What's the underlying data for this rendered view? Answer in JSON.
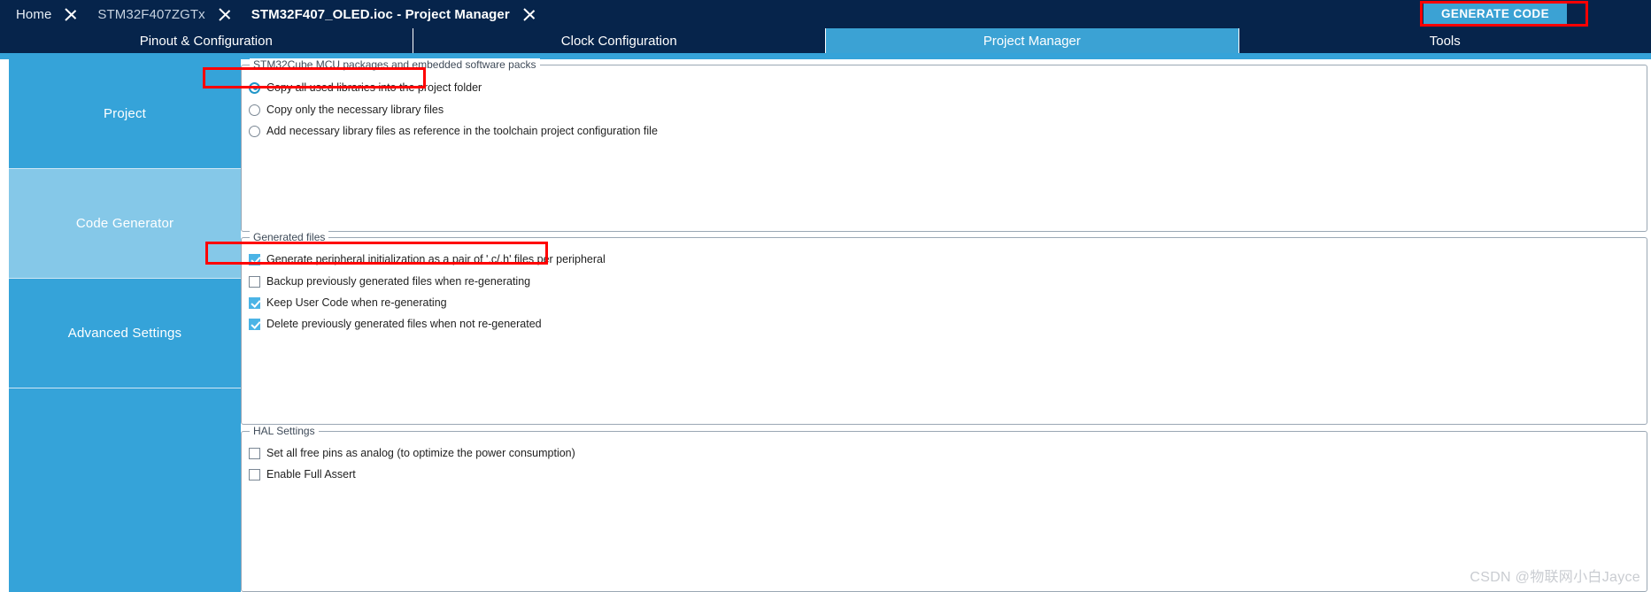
{
  "header": {
    "breadcrumbs": [
      {
        "label": "Home",
        "state": "normal"
      },
      {
        "label": "STM32F407ZGTx",
        "state": "normal"
      },
      {
        "label": "STM32F407_OLED.ioc - Project Manager",
        "state": "active"
      }
    ],
    "generate_code_label": "GENERATE CODE"
  },
  "tabs": [
    {
      "label": "Pinout & Configuration",
      "active": false
    },
    {
      "label": "Clock Configuration",
      "active": false
    },
    {
      "label": "Project Manager",
      "active": true
    },
    {
      "label": "Tools",
      "active": false
    }
  ],
  "sidebar": {
    "items": [
      {
        "label": "Project",
        "selected": false
      },
      {
        "label": "Code Generator",
        "selected": true
      },
      {
        "label": "Advanced Settings",
        "selected": false
      },
      {
        "label": "",
        "selected": false
      }
    ]
  },
  "groups": {
    "packages": {
      "title": "STM32Cube MCU packages and embedded software packs",
      "options": [
        {
          "label": "Copy all used libraries into the project folder",
          "checked": true
        },
        {
          "label": "Copy only the necessary library files",
          "checked": false
        },
        {
          "label": "Add necessary library files as reference in the toolchain project configuration file",
          "checked": false
        }
      ]
    },
    "generated_files": {
      "title": "Generated files",
      "options": [
        {
          "label": "Generate peripheral initialization as a pair of '.c/.h' files per peripheral",
          "checked": true
        },
        {
          "label": "Backup previously generated files when re-generating",
          "checked": false
        },
        {
          "label": "Keep User Code when re-generating",
          "checked": true
        },
        {
          "label": "Delete previously generated files when not re-generated",
          "checked": true
        }
      ]
    },
    "hal_settings": {
      "title": "HAL Settings",
      "options": [
        {
          "label": "Set all free pins as analog (to optimize the power consumption)",
          "checked": false
        },
        {
          "label": "Enable Full Assert",
          "checked": false
        }
      ]
    }
  },
  "watermark": "CSDN @物联网小白Jayce",
  "colors": {
    "header_navy": "#06244b",
    "accent_blue": "#3ba2d4",
    "sidebar_blue": "#35a3d9",
    "sidebar_selected": "#85c8e8",
    "annotation_red": "#ff0000",
    "checkbox_blue": "#4bb4e6"
  }
}
